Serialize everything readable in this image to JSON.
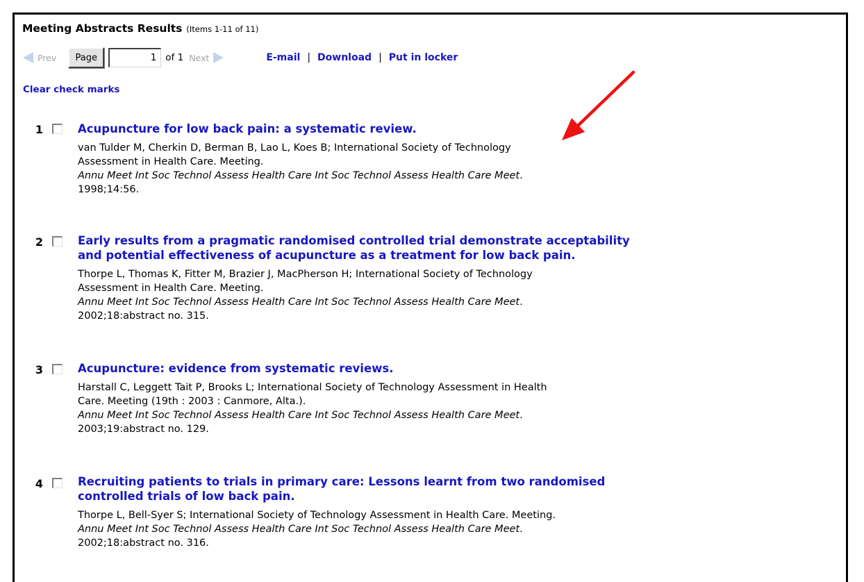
{
  "header": {
    "title": "Meeting Abstracts Results",
    "count": "(Items 1-11 of 11)"
  },
  "pager": {
    "prev_label": "Prev",
    "page_button": "Page",
    "page_value": "1",
    "of_text": "of 1",
    "next_label": "Next"
  },
  "actions": {
    "email": "E-mail",
    "download": "Download",
    "locker": "Put in locker"
  },
  "clear_label": "Clear check marks",
  "results": [
    {
      "num": "1",
      "title": "Acupuncture for low back pain: a systematic review.",
      "authors_line1": "van Tulder M, Cherkin D, Berman B, Lao L, Koes B; International Society of Technology",
      "authors_line2": "Assessment in Health Care. Meeting.",
      "journal": "Annu Meet Int Soc Technol Assess Health Care Int Soc Technol Assess Health Care Meet",
      "cite": "1998;14:56."
    },
    {
      "num": "2",
      "title_line1": "Early results from a pragmatic randomised controlled trial demonstrate acceptability",
      "title_line2": "and potential effectiveness of acupuncture as a treatment for low back pain.",
      "authors_line1": "Thorpe L, Thomas K, Fitter M, Brazier J, MacPherson H; International Society of Technology",
      "authors_line2": "Assessment in Health Care. Meeting.",
      "journal": "Annu Meet Int Soc Technol Assess Health Care Int Soc Technol Assess Health Care Meet",
      "cite": "2002;18:abstract no. 315."
    },
    {
      "num": "3",
      "title": "Acupuncture: evidence from systematic reviews.",
      "authors_line1": "Harstall C, Leggett Tait P, Brooks L; International Society of Technology Assessment in Health",
      "authors_line2": "Care. Meeting (19th : 2003 : Canmore, Alta.).",
      "journal": "Annu Meet Int Soc Technol Assess Health Care Int Soc Technol Assess Health Care Meet",
      "cite": "2003;19:abstract no. 129."
    },
    {
      "num": "4",
      "title_line1": "Recruiting patients to trials in primary care: Lessons learnt from two randomised",
      "title_line2": "controlled trials of low back pain.",
      "authors_line1": "Thorpe L, Bell-Syer S; International Society of Technology Assessment in Health Care. Meeting.",
      "journal": "Annu Meet Int Soc Technol Assess Health Care Int Soc Technol Assess Health Care Meet",
      "cite": "2002;18:abstract no. 316."
    }
  ],
  "colors": {
    "link": "#1818c0",
    "arrow": "#ee1111",
    "disabled_arrow": "#c2d4ec"
  }
}
